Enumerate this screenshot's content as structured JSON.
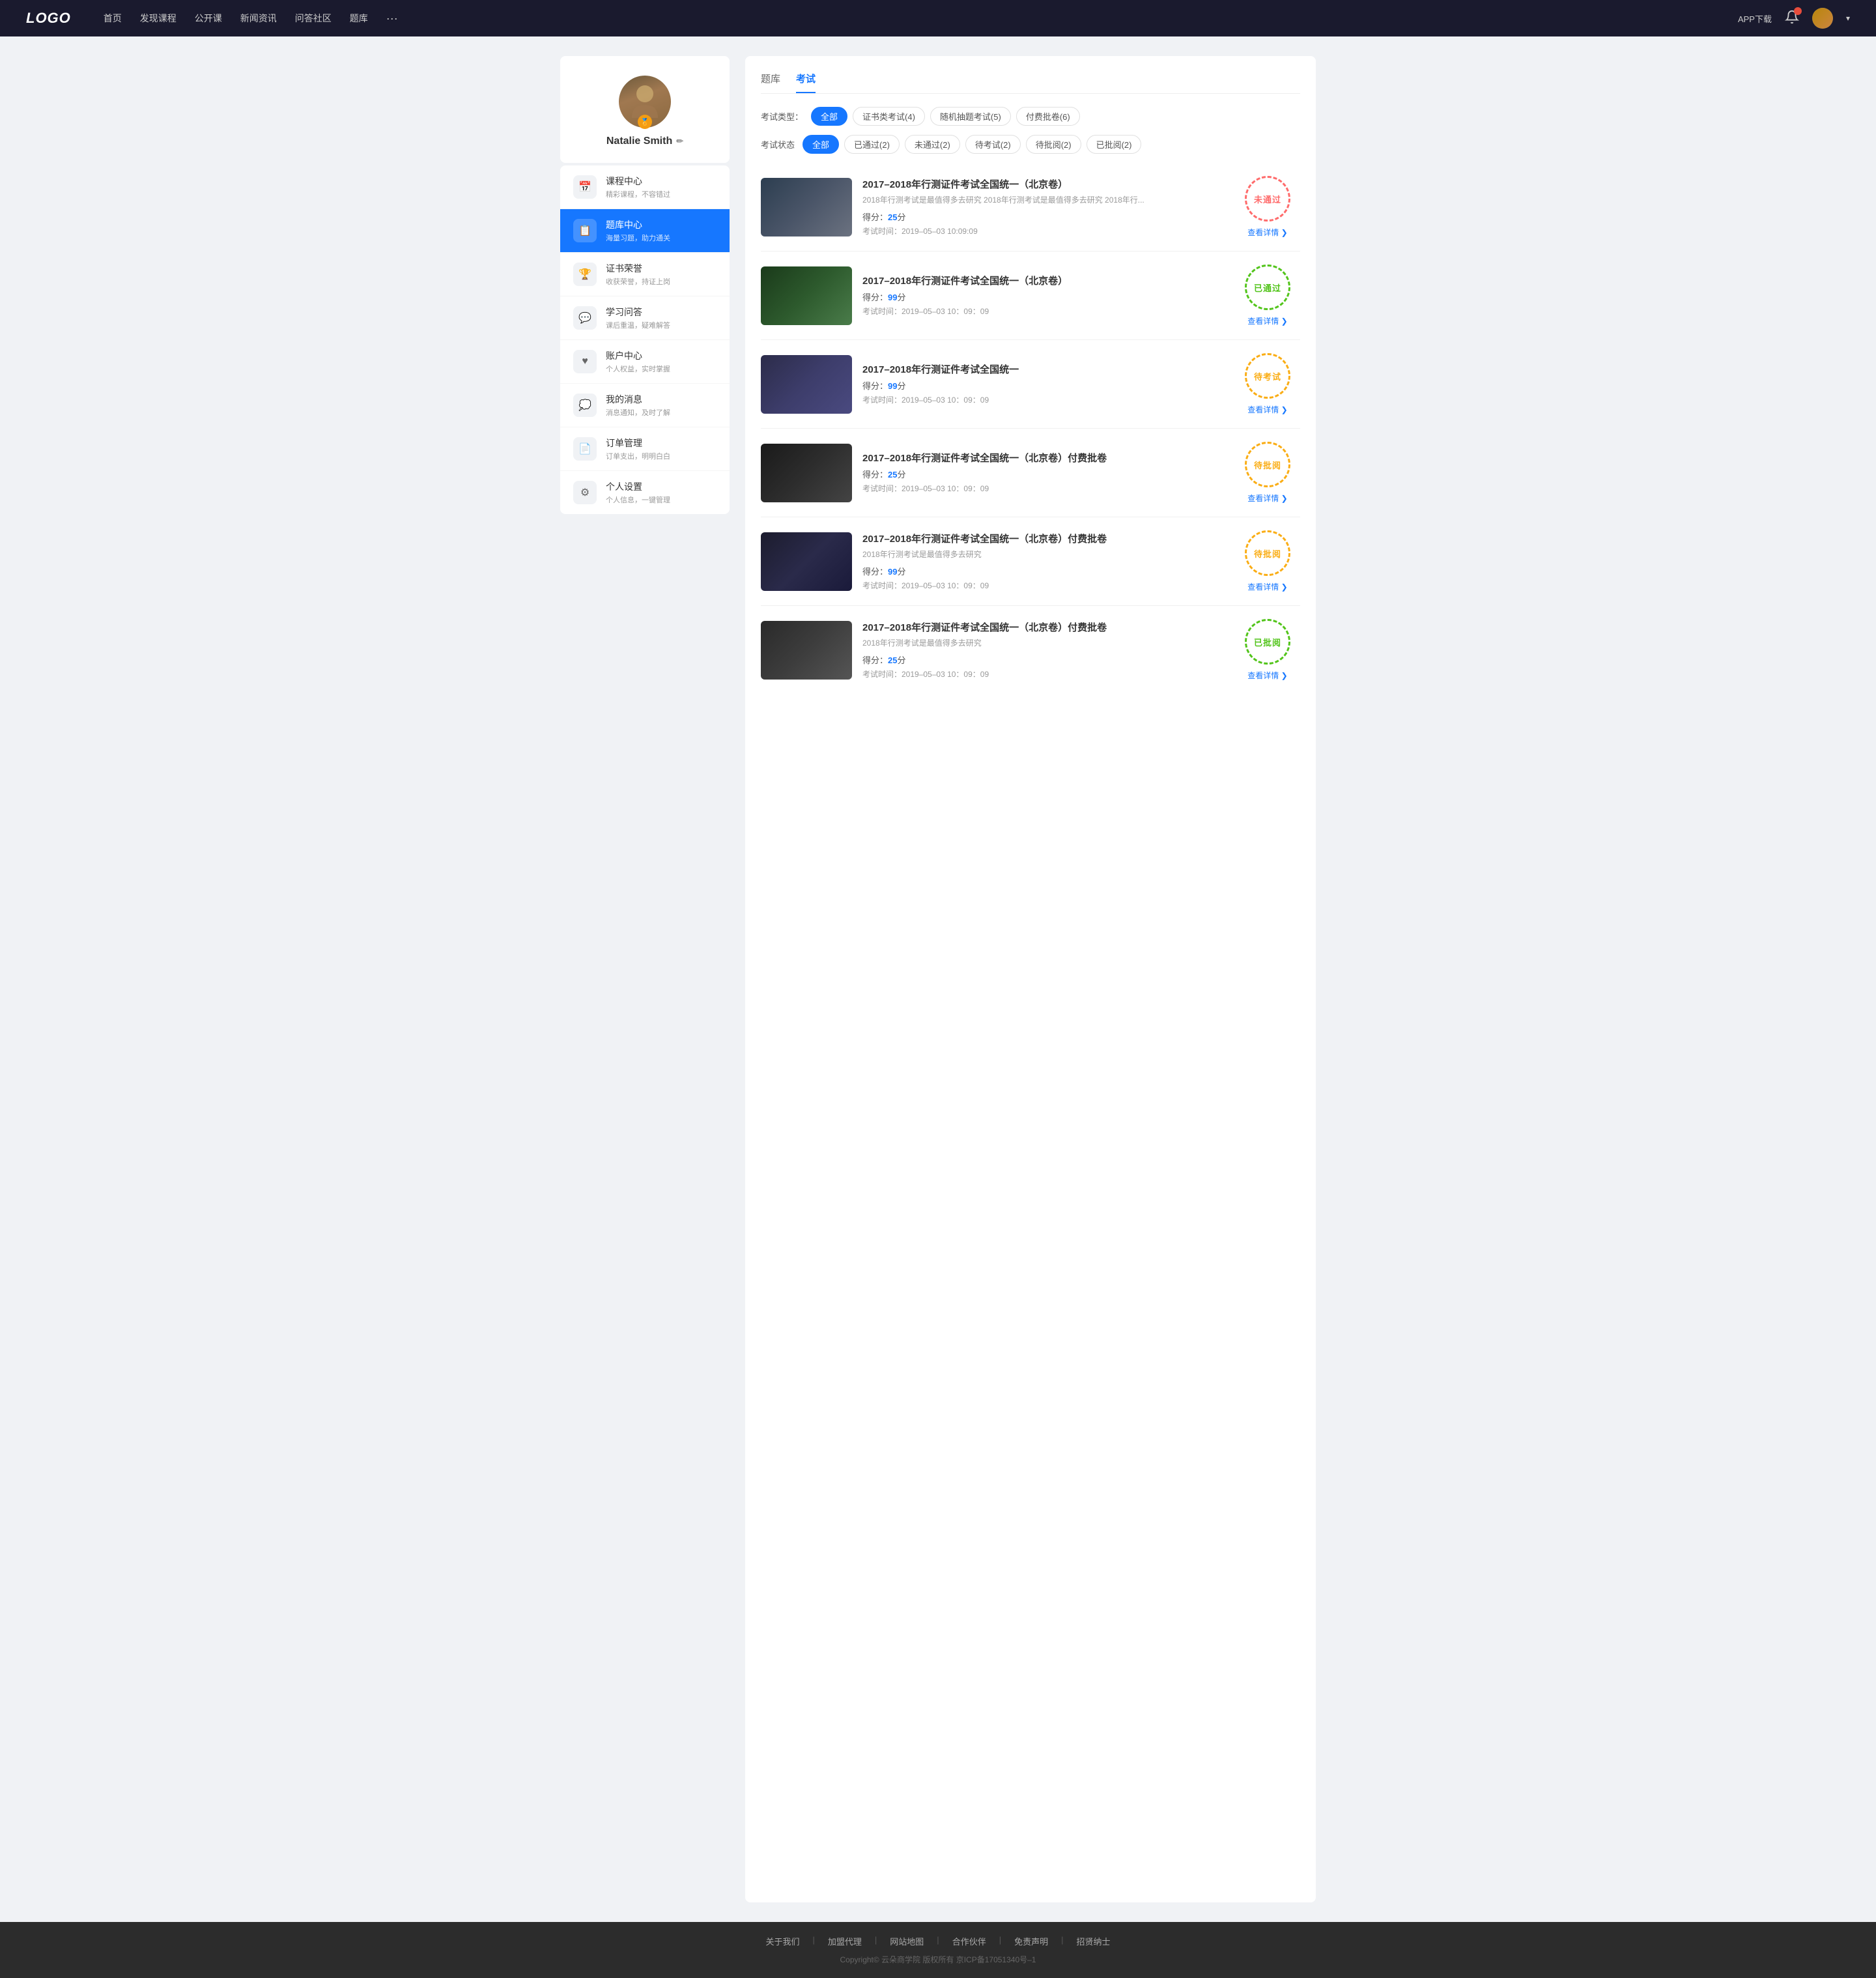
{
  "navbar": {
    "logo": "LOGO",
    "links": [
      {
        "label": "首页",
        "id": "home"
      },
      {
        "label": "发现课程",
        "id": "discover"
      },
      {
        "label": "公开课",
        "id": "opencourse"
      },
      {
        "label": "新闻资讯",
        "id": "news"
      },
      {
        "label": "问答社区",
        "id": "qa"
      },
      {
        "label": "题库",
        "id": "questionbank"
      }
    ],
    "more": "···",
    "app_download": "APP下载"
  },
  "sidebar": {
    "profile": {
      "name": "Natalie Smith",
      "badge": "🏅",
      "edit_label": "✏"
    },
    "menu": [
      {
        "id": "course-center",
        "icon": "📅",
        "label": "课程中心",
        "sub": "精彩课程，不容错过",
        "active": false
      },
      {
        "id": "question-bank",
        "icon": "📋",
        "label": "题库中心",
        "sub": "海量习题，助力通关",
        "active": true
      },
      {
        "id": "certificate",
        "icon": "🏆",
        "label": "证书荣誉",
        "sub": "收获荣誉，持证上岗",
        "active": false
      },
      {
        "id": "qa",
        "icon": "💬",
        "label": "学习问答",
        "sub": "课后重温，疑难解答",
        "active": false
      },
      {
        "id": "account",
        "icon": "♥",
        "label": "账户中心",
        "sub": "个人权益，实时掌握",
        "active": false
      },
      {
        "id": "messages",
        "icon": "💭",
        "label": "我的消息",
        "sub": "消息通知，及时了解",
        "active": false
      },
      {
        "id": "orders",
        "icon": "📄",
        "label": "订单管理",
        "sub": "订单支出，明明白白",
        "active": false
      },
      {
        "id": "settings",
        "icon": "⚙",
        "label": "个人设置",
        "sub": "个人信息，一键管理",
        "active": false
      }
    ]
  },
  "main": {
    "tabs": [
      {
        "label": "题库",
        "id": "tab-question",
        "active": false
      },
      {
        "label": "考试",
        "id": "tab-exam",
        "active": true
      }
    ],
    "filter_type": {
      "label": "考试类型：",
      "options": [
        {
          "label": "全部",
          "active": true
        },
        {
          "label": "证书类考试(4)",
          "active": false
        },
        {
          "label": "随机抽题考试(5)",
          "active": false
        },
        {
          "label": "付费批卷(6)",
          "active": false
        }
      ]
    },
    "filter_status": {
      "label": "考试状态",
      "options": [
        {
          "label": "全部",
          "active": true
        },
        {
          "label": "已通过(2)",
          "active": false
        },
        {
          "label": "未通过(2)",
          "active": false
        },
        {
          "label": "待考试(2)",
          "active": false
        },
        {
          "label": "待批阅(2)",
          "active": false
        },
        {
          "label": "已批阅(2)",
          "active": false
        }
      ]
    },
    "exams": [
      {
        "id": 1,
        "title": "2017–2018年行测证件考试全国统一（北京卷）",
        "desc": "2018年行测考试是最值得多去研究 2018年行测考试是最值得多去研究 2018年行...",
        "score_label": "得分：",
        "score": "25",
        "score_unit": "分",
        "time_label": "考试时间：",
        "time": "2019–05–03  10:09:09",
        "status_text": "未通过",
        "status_type": "fail",
        "detail_label": "查看详情",
        "thumb_class": "thumb-1"
      },
      {
        "id": 2,
        "title": "2017–2018年行测证件考试全国统一（北京卷）",
        "desc": "",
        "score_label": "得分：",
        "score": "99",
        "score_unit": "分",
        "time_label": "考试时间：",
        "time": "2019–05–03  10：09：09",
        "status_text": "已通过",
        "status_type": "pass",
        "detail_label": "查看详情",
        "thumb_class": "thumb-2"
      },
      {
        "id": 3,
        "title": "2017–2018年行测证件考试全国统一",
        "desc": "",
        "score_label": "得分：",
        "score": "99",
        "score_unit": "分",
        "time_label": "考试时间：",
        "time": "2019–05–03  10：09：09",
        "status_text": "待考试",
        "status_type": "pending",
        "detail_label": "查看详情",
        "thumb_class": "thumb-3"
      },
      {
        "id": 4,
        "title": "2017–2018年行测证件考试全国统一（北京卷）付费批卷",
        "desc": "",
        "score_label": "得分：",
        "score": "25",
        "score_unit": "分",
        "time_label": "考试时间：",
        "time": "2019–05–03  10：09：09",
        "status_text": "待批阅",
        "status_type": "review",
        "detail_label": "查看详情",
        "thumb_class": "thumb-4"
      },
      {
        "id": 5,
        "title": "2017–2018年行测证件考试全国统一（北京卷）付费批卷",
        "desc": "2018年行测考试是最值得多去研究",
        "score_label": "得分：",
        "score": "99",
        "score_unit": "分",
        "time_label": "考试时间：",
        "time": "2019–05–03  10：09：09",
        "status_text": "待批阅",
        "status_type": "review",
        "detail_label": "查看详情",
        "thumb_class": "thumb-5"
      },
      {
        "id": 6,
        "title": "2017–2018年行测证件考试全国统一（北京卷）付费批卷",
        "desc": "2018年行测考试是最值得多去研究",
        "score_label": "得分：",
        "score": "25",
        "score_unit": "分",
        "time_label": "考试时间：",
        "time": "2019–05–03  10：09：09",
        "status_text": "已批阅",
        "status_type": "reviewed",
        "detail_label": "查看详情",
        "thumb_class": "thumb-6"
      }
    ]
  },
  "footer": {
    "links": [
      "关于我们",
      "加盟代理",
      "网站地图",
      "合作伙伴",
      "免责声明",
      "招贤纳士"
    ],
    "copyright": "Copyright© 云朵商学院  版权所有    京ICP备17051340号–1"
  }
}
